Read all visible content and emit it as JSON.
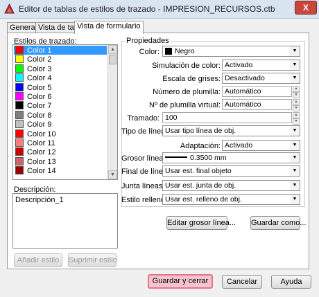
{
  "window": {
    "title": "Editor de tablas de estilos de trazado - IMPRESION_RECURSOS.ctb",
    "close_symbol": "X"
  },
  "tabs": [
    "General",
    "Vista de tabla",
    "Vista de formulario"
  ],
  "styles_list": {
    "label": "Estilos de trazado:",
    "items": [
      {
        "label": "Color 1",
        "color": "#ff0000"
      },
      {
        "label": "Color 2",
        "color": "#ffff00"
      },
      {
        "label": "Color 3",
        "color": "#00ff00"
      },
      {
        "label": "Color 4",
        "color": "#00ffff"
      },
      {
        "label": "Color 5",
        "color": "#0000ff"
      },
      {
        "label": "Color 6",
        "color": "#ff00ff"
      },
      {
        "label": "Color 7",
        "color": "#000000"
      },
      {
        "label": "Color 8",
        "color": "#808080"
      },
      {
        "label": "Color 9",
        "color": "#c0c0c0"
      },
      {
        "label": "Color 10",
        "color": "#ff0000"
      },
      {
        "label": "Color 11",
        "color": "#ff7f7f"
      },
      {
        "label": "Color 12",
        "color": "#cc0000"
      },
      {
        "label": "Color 13",
        "color": "#cc6666"
      },
      {
        "label": "Color 14",
        "color": "#990000"
      }
    ],
    "selected_index": 0
  },
  "description": {
    "label": "Descripción:",
    "value": "Descripción_1"
  },
  "left_buttons": {
    "add": "Añadir estilo",
    "delete": "Suprimir estilo"
  },
  "properties": {
    "group_title": "Propiedades",
    "color": {
      "label": "Color:",
      "value": "Negro",
      "swatch": "#000000"
    },
    "dithering": {
      "label": "Simulación de color:",
      "value": "Activado"
    },
    "grayscale": {
      "label": "Escala de grises:",
      "value": "Desactivado"
    },
    "pen_number": {
      "label": "Número de plumilla:",
      "value": "Automático"
    },
    "virtual_pen": {
      "label": "Nº de plumilla virtual:",
      "value": "Automático"
    },
    "screening": {
      "label": "Tramado:",
      "value": "100"
    },
    "linetype": {
      "label": "Tipo de línea:",
      "value": "Usar tipo línea de obj."
    },
    "adaptive": {
      "label": "Adaptación:",
      "value": "Activado"
    },
    "lineweight": {
      "label": "Grosor línea:",
      "value": "0.3500 mm"
    },
    "line_end": {
      "label": "Final de línea:",
      "value": "Usar est. final objeto"
    },
    "line_join": {
      "label": "Junta líneas:",
      "value": "Usar est. junta de obj."
    },
    "fill_style": {
      "label": "Estilo relleno:",
      "value": "Usar est. relleno de obj."
    }
  },
  "mid_buttons": {
    "edit_lineweights": "Editar grosor línea...",
    "save_as": "Guardar como..."
  },
  "bottom_buttons": {
    "save_close": "Guardar y cerrar",
    "cancel": "Cancelar",
    "help": "Ayuda"
  },
  "colors": {
    "selection": "#3399ff",
    "highlight_border": "#e8728a"
  }
}
